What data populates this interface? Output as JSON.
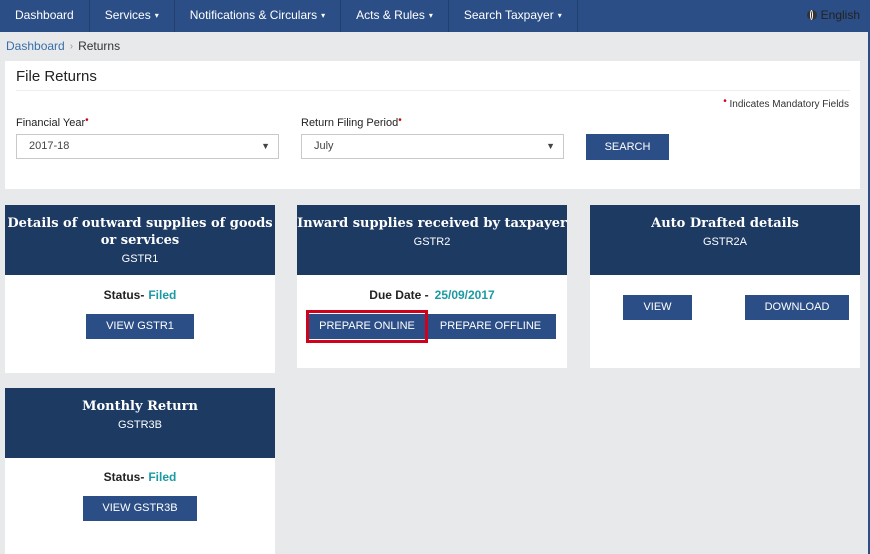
{
  "nav": {
    "items": [
      {
        "label": "Dashboard",
        "caret": ""
      },
      {
        "label": "Services",
        "caret": "▾"
      },
      {
        "label": "Notifications & Circulars",
        "caret": "▾"
      },
      {
        "label": "Acts & Rules",
        "caret": "▾"
      },
      {
        "label": "Search Taxpayer",
        "caret": "▾"
      }
    ]
  },
  "breadcrumb": {
    "home": "Dashboard",
    "separator": "›",
    "current": "Returns"
  },
  "language": "English",
  "file_returns": {
    "title": "File Returns",
    "mandatory_marker": "•",
    "mandatory_note": "Indicates Mandatory Fields",
    "financial_year_label": "Financial Year",
    "financial_year_value": "2017-18",
    "period_label": "Return Filing Period",
    "period_value": "July",
    "search_label": "SEARCH"
  },
  "cards": {
    "gstr1": {
      "title": "Details of outward supplies of goods or services",
      "code": "GSTR1",
      "status_label": "Status-",
      "status_value": "Filed",
      "button": "VIEW GSTR1"
    },
    "gstr2": {
      "title": "Inward supplies received by taxpayer",
      "code": "GSTR2",
      "due_label": "Due Date -",
      "due_value": "25/09/2017",
      "prepare_online": "PREPARE ONLINE",
      "prepare_offline": "PREPARE OFFLINE"
    },
    "gstr2a": {
      "title": "Auto Drafted details",
      "code": "GSTR2A",
      "view": "VIEW",
      "download": "DOWNLOAD"
    },
    "gstr3b": {
      "title": "Monthly Return",
      "code": "GSTR3B",
      "status_label": "Status-",
      "status_value": "Filed",
      "button": "VIEW GSTR3B"
    }
  },
  "colors": {
    "nav_bg": "#2c4e86",
    "card_header": "#1d3a63",
    "status_value": "#1b9aa4",
    "highlight": "#d0021b",
    "page_bg": "#e8e9eb"
  }
}
